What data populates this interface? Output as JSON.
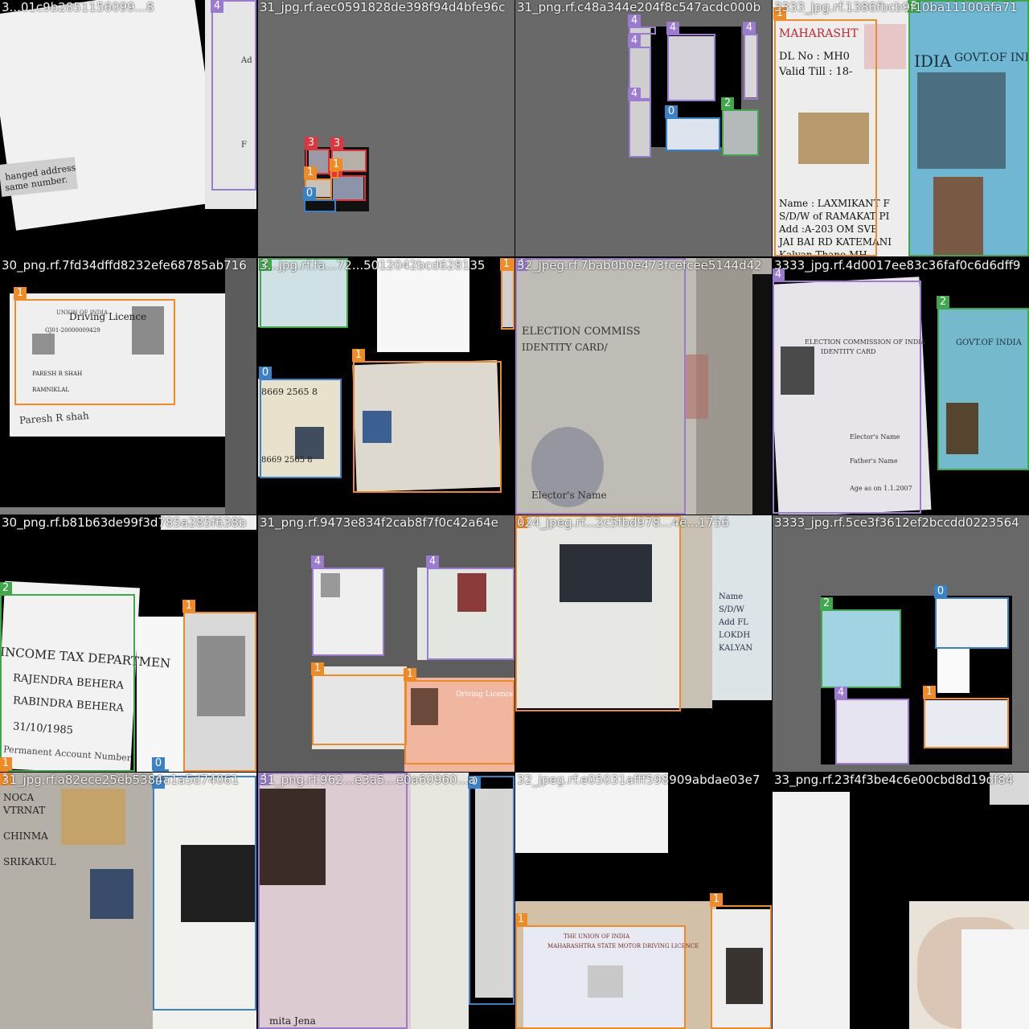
{
  "colors": {
    "class_0": "#3a82c8",
    "class_1": "#f08a24",
    "class_2": "#3ea84a",
    "class_3": "#e0343c",
    "class_4": "#9b7ad0"
  },
  "tiles": [
    {
      "name": "tile-r1c1",
      "label": "3...01c9b2851156099...8",
      "texts": [
        {
          "t": "hanged address",
          "cls": "t11"
        },
        {
          "t": "same number.",
          "cls": "t12"
        },
        {
          "t": "Ad",
          "cls": "t13"
        },
        {
          "t": "F",
          "cls": "t14"
        }
      ],
      "boxes": [
        {
          "cls": 4,
          "tag": "4"
        }
      ]
    },
    {
      "name": "tile-r1c2",
      "label": "31_jpg.rf.aec0591828de398f94d4bfe96c",
      "texts": [],
      "boxes": [
        {
          "cls": 3,
          "tag": "3"
        },
        {
          "cls": 3,
          "tag": "3"
        },
        {
          "cls": 3,
          "tag": "3"
        },
        {
          "cls": 1,
          "tag": "1"
        },
        {
          "cls": 0,
          "tag": "0"
        },
        {
          "cls": 1,
          "tag": "1"
        }
      ]
    },
    {
      "name": "tile-r1c3",
      "label": "31_png.rf.c48a344e204f8c547acdc000b",
      "texts": [],
      "boxes": [
        {
          "cls": 4,
          "tag": "4"
        },
        {
          "cls": 4,
          "tag": "4"
        },
        {
          "cls": 4,
          "tag": "4"
        },
        {
          "cls": 4,
          "tag": "4"
        },
        {
          "cls": 4,
          "tag": "4"
        },
        {
          "cls": 0,
          "tag": "0"
        },
        {
          "cls": 2,
          "tag": "2"
        }
      ]
    },
    {
      "name": "tile-r1c4",
      "label": "3333_jpg.rf.1386fbcb9f10ba11100afa71",
      "texts": [
        {
          "t": "MAHARASHT",
          "cls": "t41"
        },
        {
          "t": "DL No : MH0",
          "cls": "t42"
        },
        {
          "t": "Valid Till : 18-",
          "cls": "t43"
        },
        {
          "t": "Name : LAXMIKANT F",
          "cls": "t44"
        },
        {
          "t": "S/D/W of RAMAKAT PI",
          "cls": "t45"
        },
        {
          "t": "Add :A-203 OM SVE",
          "cls": "t46"
        },
        {
          "t": "JAI BAI RD KATEMANI",
          "cls": "t47"
        },
        {
          "t": "Kalyan,Thane,MH",
          "cls": "t48"
        },
        {
          "t": "IDIA",
          "cls": "t49"
        },
        {
          "t": "GOVT.OF INDIA",
          "cls": "t4a"
        }
      ],
      "boxes": [
        {
          "cls": 1,
          "tag": "1"
        },
        {
          "cls": 2,
          "tag": "2"
        }
      ]
    },
    {
      "name": "tile-r2c1",
      "label": "30_png.rf.7fd34dffd8232efe68785ab716",
      "texts": [
        {
          "t": "Driving Licence",
          "cls": "t51"
        },
        {
          "t": "UNION OF INDIA",
          "cls": "t52"
        },
        {
          "t": "GJ01-20000009429",
          "cls": "t53"
        },
        {
          "t": "PARESH R SHAH",
          "cls": "t54"
        },
        {
          "t": "RAMNIKLAL",
          "cls": "t55"
        },
        {
          "t": "Paresh R shah",
          "cls": "t56"
        }
      ],
      "boxes": [
        {
          "cls": 1,
          "tag": "1"
        }
      ]
    },
    {
      "name": "tile-r2c2",
      "label": "3...jpg.rf.fa...72...5012042bcd628135",
      "texts": [
        {
          "t": "8669 2565 8",
          "cls": "t61"
        },
        {
          "t": "8669 2565 8",
          "cls": "t62"
        }
      ],
      "boxes": [
        {
          "cls": 2,
          "tag": "2"
        },
        {
          "cls": 1,
          "tag": "1"
        },
        {
          "cls": 0,
          "tag": "0"
        },
        {
          "cls": 1,
          "tag": "1"
        }
      ]
    },
    {
      "name": "tile-r2c3",
      "label": "32_jpeg.rf.7bab0b0e473fcefcee5144d42",
      "texts": [
        {
          "t": "ELECTION COMMISS",
          "cls": "t71"
        },
        {
          "t": "IDENTITY CARD/",
          "cls": "t72"
        },
        {
          "t": "Elector's Name",
          "cls": "t73"
        }
      ],
      "boxes": [
        {
          "cls": 4,
          "tag": "4"
        }
      ]
    },
    {
      "name": "tile-r2c4",
      "label": "3333_jpg.rf.4d0017ee83c36faf0c6d6dff9",
      "texts": [
        {
          "t": "ELECTION COMMISSION OF INDIA",
          "cls": "t81"
        },
        {
          "t": "IDENTITY CARD",
          "cls": "t82"
        },
        {
          "t": "Elector's Name",
          "cls": "t83"
        },
        {
          "t": "Father's Name",
          "cls": "t84"
        },
        {
          "t": "Age as on 1.1.2007",
          "cls": "t85"
        },
        {
          "t": "GOVT.OF INDIA",
          "cls": "t86"
        }
      ],
      "boxes": [
        {
          "cls": 4,
          "tag": "4"
        },
        {
          "cls": 2,
          "tag": "2"
        }
      ]
    },
    {
      "name": "tile-r3c1",
      "label": "30_png.rf.b81b63de99f3d785a285f638b",
      "texts": [
        {
          "t": "INCOME TAX DEPARTMEN",
          "cls": "t91"
        },
        {
          "t": "RAJENDRA BEHERA",
          "cls": "t92"
        },
        {
          "t": "RABINDRA BEHERA",
          "cls": "t93"
        },
        {
          "t": "31/10/1985",
          "cls": "t94"
        },
        {
          "t": "Permanent Account Number",
          "cls": "t95"
        }
      ],
      "boxes": [
        {
          "cls": 2,
          "tag": "2"
        },
        {
          "cls": 1,
          "tag": "1"
        },
        {
          "cls": 1,
          "tag": "1"
        },
        {
          "cls": 0,
          "tag": "0"
        }
      ]
    },
    {
      "name": "tile-r3c2",
      "label": "31_png.rf.9473e834f2cab8f7f0c42a64e",
      "texts": [
        {
          "t": "Driving Licence",
          "cls": "ta1"
        }
      ],
      "boxes": [
        {
          "cls": 4,
          "tag": "4"
        },
        {
          "cls": 4,
          "tag": "4"
        },
        {
          "cls": 1,
          "tag": "1"
        },
        {
          "cls": 1,
          "tag": "1"
        }
      ]
    },
    {
      "name": "tile-r3c3",
      "label": "024_jpeg.rf...2c5fbd978...4e...1756",
      "texts": [
        {
          "t": "Name",
          "cls": "tb1"
        },
        {
          "t": "S/D/W",
          "cls": "tb2"
        },
        {
          "t": "Add FL",
          "cls": "tb3"
        },
        {
          "t": "LOKDH",
          "cls": "tb4"
        },
        {
          "t": "KALYAN",
          "cls": "tb5"
        }
      ],
      "boxes": [
        {
          "cls": 1,
          "tag": "1"
        }
      ]
    },
    {
      "name": "tile-r3c4",
      "label": "3333_jpg.rf.5ce3f3612ef2bccdd0223564",
      "texts": [],
      "boxes": [
        {
          "cls": 2,
          "tag": "2"
        },
        {
          "cls": 0,
          "tag": "0"
        },
        {
          "cls": 4,
          "tag": "4"
        },
        {
          "cls": 1,
          "tag": "1"
        }
      ]
    },
    {
      "name": "tile-r4c1",
      "label": "31_jpg.rf.a82ece25eb5384a1a5d74061",
      "texts": [
        {
          "t": "NOCA",
          "cls": "tc1"
        },
        {
          "t": "VTRNAT",
          "cls": "tc2"
        },
        {
          "t": "CHINMA",
          "cls": "tc3"
        },
        {
          "t": "SRIKAKUL",
          "cls": "tc4"
        }
      ],
      "boxes": [
        {
          "cls": 1,
          "tag": "1"
        },
        {
          "cls": 0,
          "tag": "0"
        }
      ]
    },
    {
      "name": "tile-r4c2",
      "label": "31_png.rf.962...e3a5...e0a60960...a",
      "texts": [
        {
          "t": "mita Jena",
          "cls": "td1"
        }
      ],
      "boxes": [
        {
          "cls": 4,
          "tag": "4"
        },
        {
          "cls": 0,
          "tag": "0"
        }
      ]
    },
    {
      "name": "tile-r4c3",
      "label": "32_jpeg.rf.e05031afff598909abdae03e7",
      "texts": [
        {
          "t": "THE UNION OF INDIA",
          "cls": "te1"
        },
        {
          "t": "MAHARASHTRA STATE MOTOR DRIVING LICENCE",
          "cls": "te2"
        }
      ],
      "boxes": [
        {
          "cls": 1,
          "tag": "1"
        },
        {
          "cls": 1,
          "tag": "1"
        }
      ]
    },
    {
      "name": "tile-r4c4",
      "label": "33_png.rf.23f4f3be4c6e00cbd8d19df84",
      "texts": [],
      "boxes": []
    }
  ]
}
